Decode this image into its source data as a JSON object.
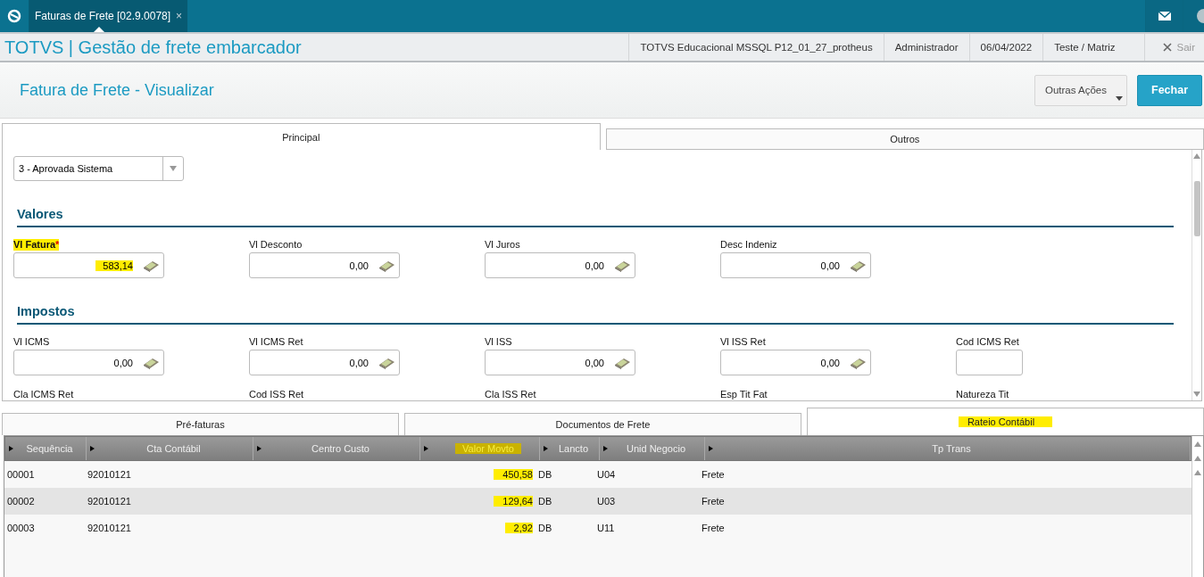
{
  "top_bar": {
    "tab": {
      "label": "Faturas de Frete [02.9.0078]",
      "close": "×"
    }
  },
  "header": {
    "title": "TOTVS | Gestão de frete embarcador",
    "info": [
      "TOTVS Educacional MSSQL P12_01_27_protheus",
      "Administrador",
      "06/04/2022",
      "Teste / Matriz"
    ],
    "exit": "Sair"
  },
  "page": {
    "title": "Fatura de Frete - Visualizar",
    "actions": [
      {
        "label": "Outras Ações",
        "kind": "menu"
      },
      {
        "label": "Fechar",
        "kind": "primary"
      }
    ]
  },
  "form_tabs": [
    {
      "label": "Principal",
      "selected": true
    },
    {
      "label": "Outros",
      "selected": false
    }
  ],
  "combo": {
    "value": "3 - Aprovada Sistema"
  },
  "sections": [
    {
      "title": "Valores",
      "fields": [
        {
          "label": "Vl Fatura",
          "required_mark": "*",
          "highlighted": true,
          "kind": "money",
          "value": "583,14"
        },
        {
          "label": "Vl Desconto",
          "highlighted": false,
          "kind": "money",
          "value": "0,00"
        },
        {
          "label": "Vl Juros",
          "highlighted": false,
          "kind": "money",
          "value": "0,00"
        },
        {
          "label": "Desc Indeniz",
          "highlighted": false,
          "kind": "money",
          "value": "0,00"
        }
      ]
    },
    {
      "title": "Impostos",
      "fields": [
        {
          "label": "Vl ICMS",
          "highlighted": false,
          "kind": "money",
          "value": "0,00"
        },
        {
          "label": "Vl ICMS Ret",
          "highlighted": false,
          "kind": "money",
          "value": "0,00"
        },
        {
          "label": "Vl ISS",
          "highlighted": false,
          "kind": "money",
          "value": "0,00"
        },
        {
          "label": "Vl ISS Ret",
          "highlighted": false,
          "kind": "money",
          "value": "0,00"
        },
        {
          "label": "Cod ICMS Ret",
          "highlighted": false,
          "kind": "short"
        },
        {
          "label": "Cla ICMS Ret",
          "highlighted": false,
          "kind": "hidden"
        },
        {
          "label": "Cod ISS Ret",
          "highlighted": false,
          "kind": "hidden"
        },
        {
          "label": "Cla ISS Ret",
          "highlighted": false,
          "kind": "hidden"
        },
        {
          "label": "Esp Tit Fat",
          "highlighted": false,
          "kind": "hidden"
        },
        {
          "label": "Natureza Tit",
          "highlighted": false,
          "kind": "hidden"
        }
      ]
    }
  ],
  "grid_tabs": [
    {
      "label": "Pré-faturas",
      "selected": false,
      "highlighted": false
    },
    {
      "label": "Documentos de Frete",
      "selected": false,
      "highlighted": false
    },
    {
      "label": "Rateio Contábil",
      "selected": true,
      "highlighted": true
    }
  ],
  "table": {
    "columns": [
      {
        "label": "Sequência",
        "highlighted": false
      },
      {
        "label": "Cta Contábil",
        "highlighted": false
      },
      {
        "label": "Centro Custo",
        "highlighted": false
      },
      {
        "label": "Valor Movto",
        "highlighted": true
      },
      {
        "label": "Lancto",
        "highlighted": false
      },
      {
        "label": "Unid Negocio",
        "highlighted": false
      },
      {
        "label": "Tp Trans",
        "highlighted": false
      }
    ],
    "rows": [
      {
        "selected": false,
        "cells": [
          {
            "text": "00001"
          },
          {
            "text": "92010121"
          },
          {},
          {
            "text": "450,58",
            "highlighted": true
          },
          {
            "text": "DB"
          },
          {
            "text": "U04"
          },
          {
            "text": "Frete"
          }
        ]
      },
      {
        "selected": true,
        "cells": [
          {
            "text": "00002"
          },
          {
            "text": "92010121"
          },
          {},
          {
            "text": "129,64",
            "highlighted": true
          },
          {
            "text": "DB"
          },
          {
            "text": "U03"
          },
          {
            "text": "Frete"
          }
        ]
      },
      {
        "selected": false,
        "cells": [
          {
            "text": "00003"
          },
          {
            "text": "92010121"
          },
          {},
          {
            "text": "2,92",
            "highlighted": true
          },
          {
            "text": "DB"
          },
          {
            "text": "U11"
          },
          {
            "text": "Frete"
          }
        ]
      }
    ]
  }
}
